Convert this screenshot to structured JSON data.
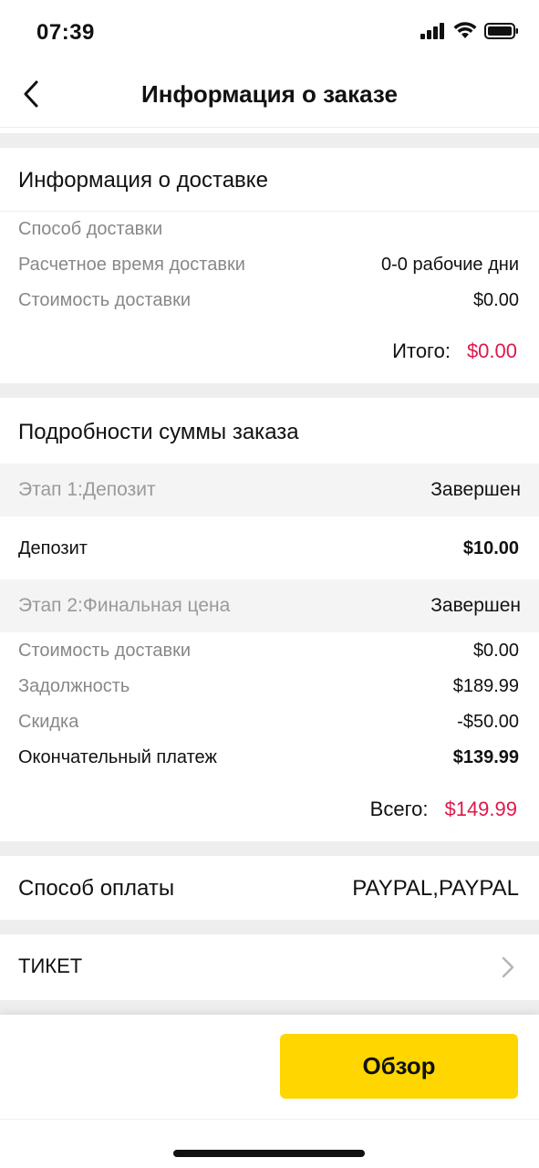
{
  "status": {
    "time": "07:39"
  },
  "header": {
    "title": "Информация о заказе"
  },
  "delivery": {
    "title": "Информация о доставке",
    "rows": [
      {
        "label": "Способ доставки",
        "value": ""
      },
      {
        "label": "Расчетное время доставки",
        "value": "0-0 рабочие дни"
      },
      {
        "label": "Стоимость доставки",
        "value": "$0.00"
      }
    ],
    "total_label": "Итого:",
    "total_value": "$0.00"
  },
  "amount": {
    "title": "Подробности суммы заказа",
    "stage1": {
      "label": "Этап 1:Депозит",
      "status": "Завершен"
    },
    "deposit": {
      "label": "Депозит",
      "value": "$10.00"
    },
    "stage2": {
      "label": "Этап 2:Финальная цена",
      "status": "Завершен"
    },
    "rows": [
      {
        "label": "Стоимость доставки",
        "value": "$0.00"
      },
      {
        "label": "Задолжность",
        "value": "$189.99"
      },
      {
        "label": "Скидка",
        "value": "-$50.00"
      }
    ],
    "final": {
      "label": "Окончательный платеж",
      "value": "$139.99"
    },
    "total_label": "Всего:",
    "total_value": "$149.99"
  },
  "payment": {
    "label": "Способ оплаты",
    "value": "PAYPAL,PAYPAL"
  },
  "ticket": {
    "label": "ТИКЕТ"
  },
  "footer": {
    "review_label": "Обзор"
  },
  "colors": {
    "accent": "#ffd600",
    "price": "#e0174a",
    "separator": "#eeeeee"
  }
}
